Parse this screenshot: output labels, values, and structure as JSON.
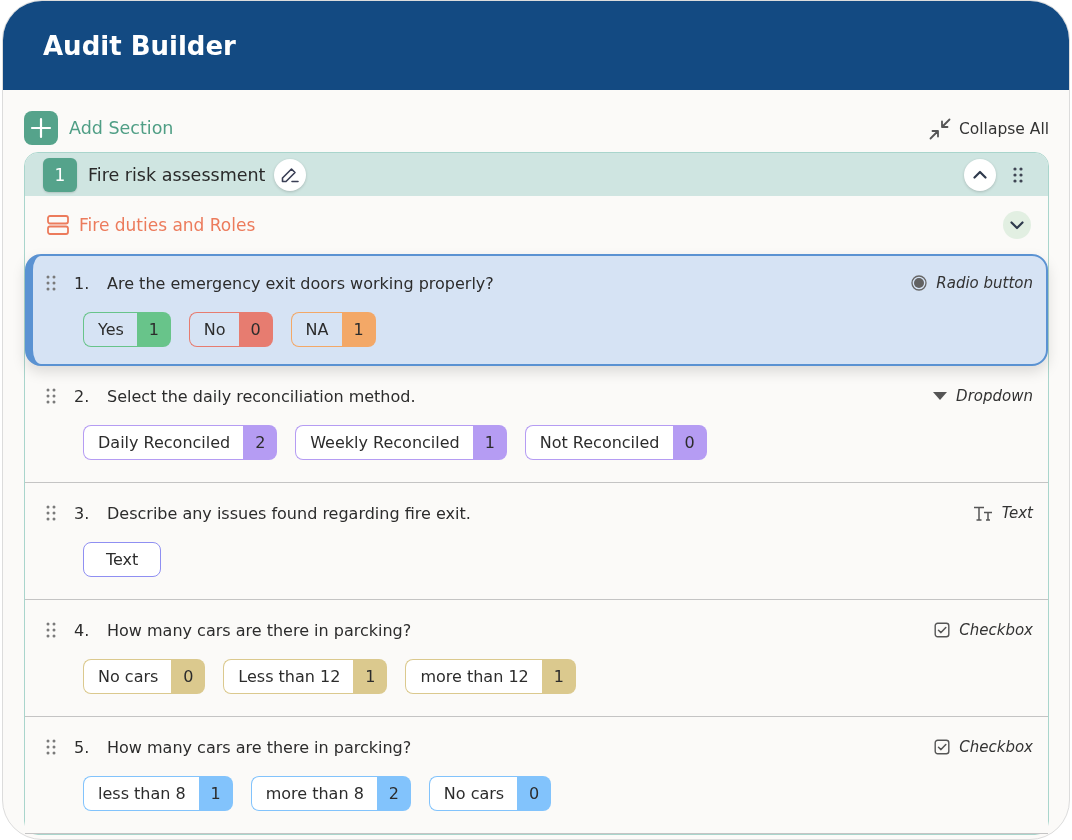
{
  "header": {
    "title": "Audit Builder"
  },
  "toolbar": {
    "add_section": "Add Section",
    "collapse_all": "Collapse All"
  },
  "section": {
    "number": "1",
    "title": "Fire risk assessment",
    "expanded": true,
    "subsection": {
      "title": "Fire duties and Roles"
    },
    "questions": [
      {
        "number": "1.",
        "text": "Are the emergency exit doors working properly?",
        "kind": "radio",
        "type_label": "Radio button",
        "selected": true,
        "options": [
          {
            "label": "Yes",
            "count": "1",
            "color": "#68c48a"
          },
          {
            "label": "No",
            "count": "0",
            "color": "#e77c70"
          },
          {
            "label": "NA",
            "count": "1",
            "color": "#f3a867"
          }
        ]
      },
      {
        "number": "2.",
        "text": "Select the daily reconciliation method.",
        "kind": "dropdown",
        "type_label": "Dropdown",
        "selected": false,
        "options": [
          {
            "label": "Daily Reconciled",
            "count": "2",
            "color": "#b59cf3"
          },
          {
            "label": "Weekly Reconciled",
            "count": "1",
            "color": "#b59cf3"
          },
          {
            "label": "Not Reconciled",
            "count": "0",
            "color": "#b59cf3"
          }
        ]
      },
      {
        "number": "3.",
        "text": "Describe any issues found regarding fire exit.",
        "kind": "text",
        "type_label": "Text",
        "selected": false,
        "options": [
          {
            "label": "Text",
            "color": "#8f8ff2"
          }
        ]
      },
      {
        "number": "4.",
        "text": "How many cars are there in parcking?",
        "kind": "checkbox",
        "type_label": "Checkbox",
        "selected": false,
        "options": [
          {
            "label": "No cars",
            "count": "0",
            "color": "#dbc98e"
          },
          {
            "label": "Less than 12",
            "count": "1",
            "color": "#dbc98e"
          },
          {
            "label": "more than 12",
            "count": "1",
            "color": "#dbc98e"
          }
        ]
      },
      {
        "number": "5.",
        "text": "How many cars are there in parcking?",
        "kind": "checkbox",
        "type_label": "Checkbox",
        "selected": false,
        "options": [
          {
            "label": "less than 8",
            "count": "1",
            "color": "#82c3fc"
          },
          {
            "label": "more than 8",
            "count": "2",
            "color": "#82c3fc"
          },
          {
            "label": "No cars",
            "count": "0",
            "color": "#82c3fc"
          }
        ]
      }
    ]
  }
}
